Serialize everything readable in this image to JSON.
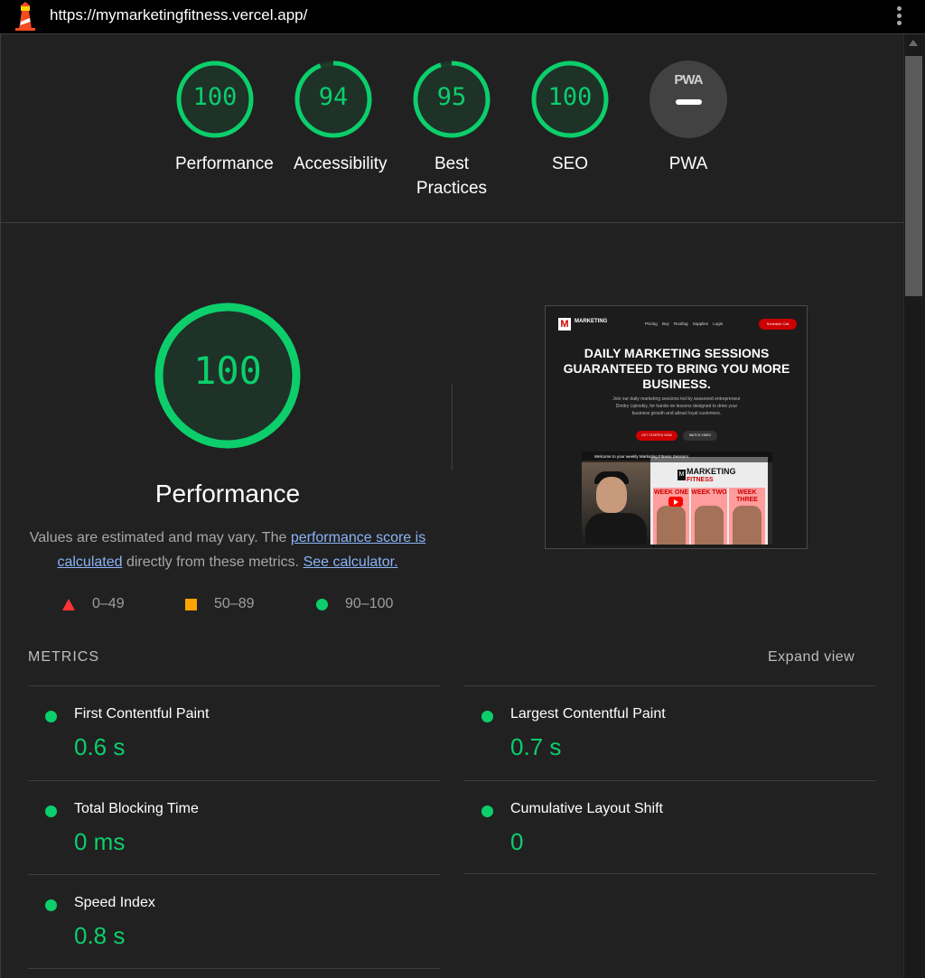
{
  "browser": {
    "url": "https://mymarketingfitness.vercel.app/",
    "logo_icon": "lighthouse-icon",
    "menu_icon": "kebab-menu-icon"
  },
  "colors": {
    "pass": "#0cce6b",
    "average": "#ffa400",
    "fail": "#ff3333",
    "background": "#212121"
  },
  "gauges": [
    {
      "label": "Performance",
      "score": "100",
      "value": 1.0
    },
    {
      "label": "Accessibility",
      "score": "94",
      "value": 0.94
    },
    {
      "label": "Best Practices",
      "score": "95",
      "value": 0.95
    },
    {
      "label": "SEO",
      "score": "100",
      "value": 1.0
    },
    {
      "label": "PWA",
      "badge": "PWA",
      "score": "—"
    }
  ],
  "performance": {
    "score": "100",
    "value": 1.0,
    "title": "Performance",
    "desc_pre": "Values are estimated and may vary. The ",
    "desc_link1": "performance score is calculated",
    "desc_mid": " directly from these metrics. ",
    "desc_link2": "See calculator."
  },
  "legend": {
    "fail": "0–49",
    "average": "50–89",
    "pass": "90–100"
  },
  "screenshot": {
    "brand": "MARKETING",
    "nav_links": "Pricing Buy Roofing Supplies Login",
    "cta": "Schedule Call",
    "headline": "DAILY MARKETING SESSIONS GUARANTEED TO BRING YOU MORE BUSINESS.",
    "subtext": "Join our daily marketing sessions led by seasoned entrepreneur Dmitry Lipinskiy, for hands-on lessons designed to drive your business growth and attract loyal customers.",
    "btn_primary": "GET STARTED NOW",
    "btn_secondary": "WATCH VIDEO",
    "video_title": "Welcome to your weekly Marketing Fitness Session!",
    "card_title": "MARKETING",
    "card_subtitle": "FITNESS",
    "weeks": [
      "WEEK ONE",
      "WEEK TWO",
      "WEEK THREE"
    ]
  },
  "metrics": {
    "title": "METRICS",
    "expand": "Expand view",
    "items": [
      {
        "name": "First Contentful Paint",
        "value": "0.6 s"
      },
      {
        "name": "Largest Contentful Paint",
        "value": "0.7 s"
      },
      {
        "name": "Total Blocking Time",
        "value": "0 ms"
      },
      {
        "name": "Cumulative Layout Shift",
        "value": "0"
      },
      {
        "name": "Speed Index",
        "value": "0.8 s"
      }
    ]
  }
}
